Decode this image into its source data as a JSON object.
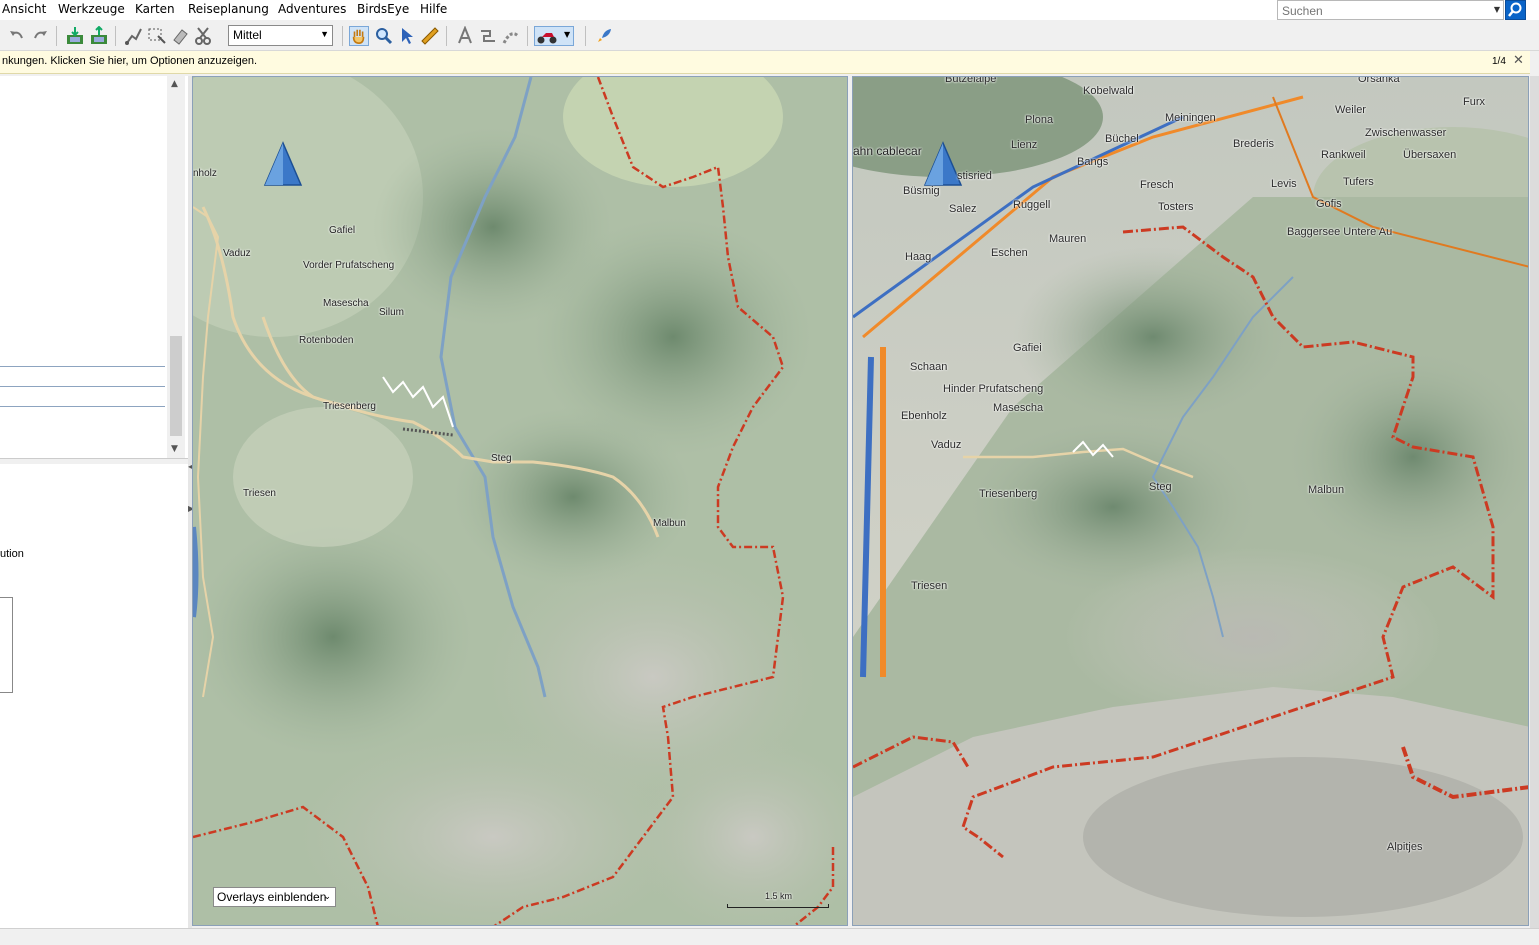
{
  "menu": [
    "Ansicht",
    "Werkzeuge",
    "Karten",
    "Reiseplanung",
    "Adventures",
    "BirdsEye",
    "Hilfe"
  ],
  "search": {
    "placeholder": "Suchen",
    "icon": "search-icon"
  },
  "toolbar": {
    "detail_value": "Mittel",
    "icons": [
      "undo-icon",
      "redo-icon",
      "send-to-device-icon",
      "receive-from-device-icon",
      "new-route-icon",
      "select-area-icon",
      "eraser-icon",
      "scissors-icon",
      "hand-pan-icon",
      "zoom-icon",
      "select-arrow-icon",
      "measure-ruler-icon",
      "waypoint-icon",
      "route-icon",
      "track-icon",
      "vehicle-profile-icon",
      "dropdown-arrow-icon",
      "rocket-icon"
    ]
  },
  "infobar": {
    "text": "nkungen. Klicken Sie hier, um Optionen anzuzeigen.",
    "count": "1/4"
  },
  "left_panel": {
    "text": "ution"
  },
  "map2d": {
    "labels": [
      "nholz",
      "Vaduz",
      "Gafiel",
      "Vorder Prufatscheng",
      "Masescha",
      "Silum",
      "Rotenboden",
      "Triesenberg",
      "Steg",
      "Malbun",
      "Triesen"
    ],
    "overlay_dropdown": "Overlays einblenden",
    "scale": "1.5 km"
  },
  "map3d": {
    "labels": [
      "Butzelalpe",
      "Kobelwald",
      "Orsanka",
      "Furx",
      "Plona",
      "Meiningen",
      "Weiler",
      "Zwischenwasser",
      "Büchel",
      "Brederis",
      "Rankweil",
      "Übersaxen",
      "Lienz",
      "Bangs",
      "ahn cablecar",
      "Büsmig",
      "stisried",
      "Fresch",
      "Levis",
      "Tufers",
      "Salez",
      "Ruggell",
      "Tosters",
      "Gofis",
      "Baggersee Untere Au",
      "Mauren",
      "Haag",
      "Eschen",
      "Gafiei",
      "Schaan",
      "Hinder Prufatscheng",
      "Masescha",
      "Ebenholz",
      "Vaduz",
      "Triesenberg",
      "Steg",
      "Malbun",
      "Triesen",
      "Alpitjes"
    ]
  }
}
